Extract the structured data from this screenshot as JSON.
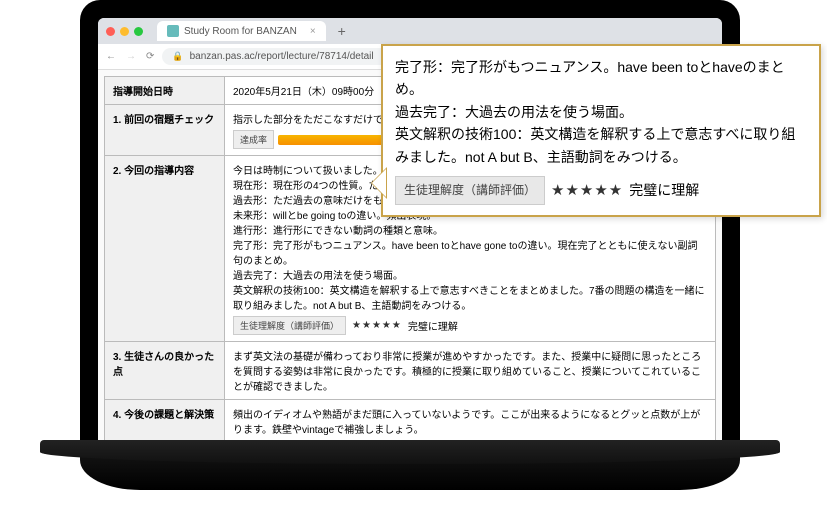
{
  "browser": {
    "tab_title": "Study Room for BANZAN",
    "url": "banzan.pas.ac/report/lecture/78714/detail"
  },
  "table": {
    "rows": [
      {
        "label": "指導開始日時",
        "text": "2020年5月21日（木）09時00分"
      },
      {
        "label": "1. 前回の宿題チェック",
        "text": "指示した部分をただこなすだけでなく、自分が分かったところと分からなかったところ",
        "achievement": {
          "label": "達成率",
          "pct": "100%"
        }
      },
      {
        "label": "2. 今回の指導内容",
        "text": "今日は時制について扱いました。\n現在形：現在形の4つの性質。ただ現在のことを表すだけではない。\n過去形：ただ過去の意味だけをもつだけでなく距離感を表す。\n未来形：willとbe going toの違い。頻出表現。\n進行形：進行形にできない動詞の種類と意味。\n完了形：完了形がもつニュアンス。have been toとhave gone toの違い。現在完了とともに使えない副詞句のまとめ。\n過去完了：大過去の用法を使う場面。\n英文解釈の技術100：英文構造を解釈する上で意志すべきことをまとめました。7番の問題の構造を一緒に取り組みました。not A but B、主語動詞をみつける。",
        "rating": {
          "label": "生徒理解度（講師評価）",
          "stars": "★★★★★",
          "text": "完璧に理解"
        }
      },
      {
        "label": "3. 生徒さんの良かった点",
        "text": "まず英文法の基礎が備わっており非常に授業が進めやすかったです。また、授業中に疑問に思ったところを質問する姿勢は非常に良かったです。積極的に授業に取り組めていること、授業についてこれていることが確認できました。"
      },
      {
        "label": "4. 今後の課題と解決策",
        "text": "頻出のイディオムや熟語がまだ頭に入っていないようです。ここが出来るようになるとグッと点数が上がります。鉄壁やvintageで補強しましょう。"
      }
    ]
  },
  "callout": {
    "text": "完了形：完了形がもつニュアンス。have been toとhaveのまとめ。\n過去完了：大過去の用法を使う場面。\n英文解釈の技術100：英文構造を解釈する上で意志すべに取り組みました。not A but B、主語動詞をみつける。",
    "rating": {
      "label": "生徒理解度（講師評価）",
      "stars": "★★★★★",
      "text": "完璧に理解"
    }
  }
}
